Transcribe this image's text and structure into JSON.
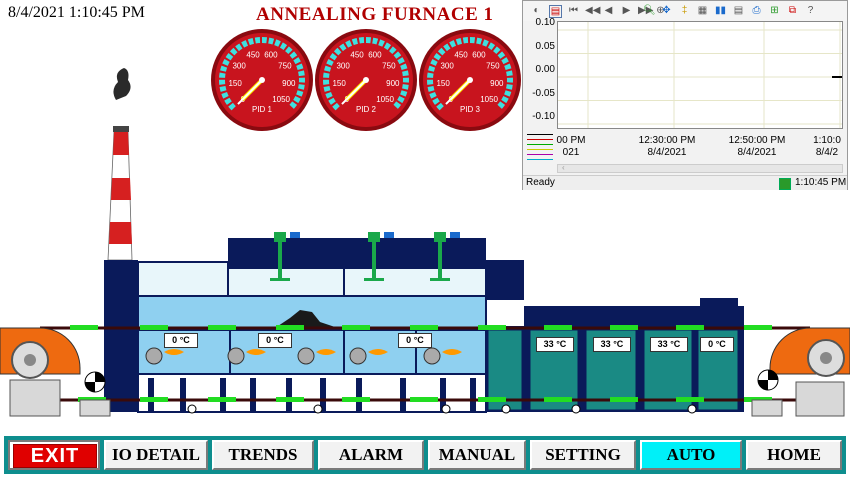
{
  "header": {
    "datetime": "8/4/2021 1:10:45 PM",
    "title": "ANNEALING FURNACE 1"
  },
  "gauges": [
    {
      "label": "PID 1",
      "ticks": [
        "0",
        "150",
        "300",
        "450",
        "600",
        "750",
        "900",
        "1050"
      ],
      "value": 0
    },
    {
      "label": "PID 2",
      "ticks": [
        "0",
        "150",
        "300",
        "450",
        "600",
        "750",
        "900",
        "1050"
      ],
      "value": 0
    },
    {
      "label": "PID 3",
      "ticks": [
        "0",
        "150",
        "300",
        "450",
        "600",
        "750",
        "900",
        "1050"
      ],
      "value": 0
    }
  ],
  "trend": {
    "y_ticks": [
      "0.10",
      "0.05",
      "0.00",
      "-0.05",
      "-0.10"
    ],
    "x_labels": [
      {
        "time": "00 PM",
        "date": "021"
      },
      {
        "time": "12:30:00 PM",
        "date": "8/4/2021"
      },
      {
        "time": "12:50:00 PM",
        "date": "8/4/2021"
      },
      {
        "time": "1:10:0",
        "date": "8/4/2"
      }
    ],
    "status_left": "Ready",
    "status_right": "1:10:45 PM",
    "legend_colors": [
      "#000000",
      "#cc0000",
      "#00aa00",
      "#cccc00",
      "#aa00aa",
      "#00aacc"
    ]
  },
  "chart_data": {
    "type": "line",
    "ylim": [
      -0.1,
      0.1
    ],
    "y_ticks": [
      0.1,
      0.05,
      0.0,
      -0.05,
      -0.1
    ],
    "x_tick_labels": [
      "00 PM 021",
      "12:30:00 PM 8/4/2021",
      "12:50:00 PM 8/4/2021",
      "1:10:0 8/4/2"
    ],
    "series": [
      {
        "values": [
          0.0
        ]
      }
    ],
    "grid": true
  },
  "furnace": {
    "zone_temps": [
      "0",
      "0",
      "0",
      "0"
    ],
    "zone_unit": "°C",
    "cool_temps": [
      "33",
      "33",
      "33",
      "0"
    ],
    "cool_unit": "°C"
  },
  "nav": {
    "exit": "EXIT",
    "buttons": [
      "IO DETAIL",
      "TRENDS",
      "ALARM",
      "MANUAL",
      "SETTING",
      "AUTO",
      "HOME"
    ],
    "active": "AUTO"
  },
  "colors": {
    "title": "#b00000",
    "nav_bg": "#0e8e8e",
    "active_btn": "#00f0f8",
    "gauge_red": "#c8141e",
    "furnace_blue": "#8fd0f0",
    "cooling_teal": "#1a8a84",
    "frame_navy": "#0a1a5a",
    "roller_green": "#22dd22",
    "fan_orange": "#ee6a10"
  }
}
